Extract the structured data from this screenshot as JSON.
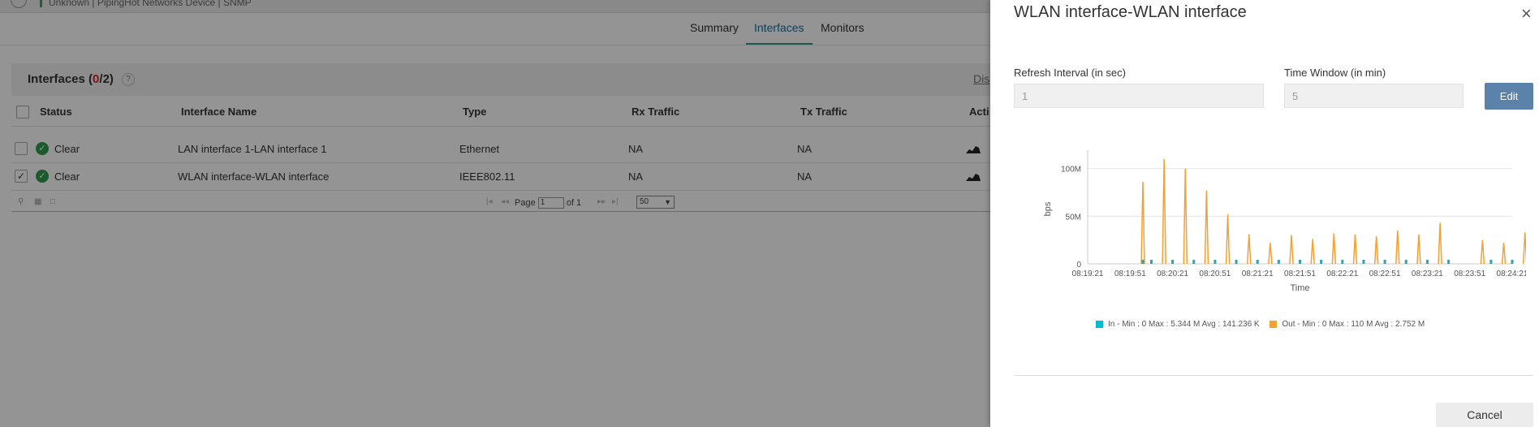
{
  "topbar": {
    "breadcrumb": "Unknown | PipingHot Networks Device  | SNMP"
  },
  "tabs": [
    {
      "label": "Summary",
      "active": false
    },
    {
      "label": "Interfaces",
      "active": true
    },
    {
      "label": "Monitors",
      "active": false
    }
  ],
  "interfaces": {
    "title": "Interfaces",
    "count_open": "(",
    "count_selected": "0",
    "count_sep": "/",
    "count_total": "2",
    "count_close": ")",
    "help": "?",
    "disable_link": "Dis",
    "columns": [
      "Status",
      "Interface Name",
      "Type",
      "Rx Traffic",
      "Tx Traffic",
      "Acti"
    ],
    "rows": [
      {
        "checked": false,
        "status": "Clear",
        "name": "LAN interface 1-LAN interface 1",
        "type": "Ethernet",
        "rx": "NA",
        "tx": "NA"
      },
      {
        "checked": true,
        "status": "Clear",
        "name": "WLAN interface-WLAN interface",
        "type": "IEEE802.11",
        "rx": "NA",
        "tx": "NA"
      }
    ],
    "pager": {
      "page_label": "Page",
      "page_value": "1",
      "of_label": "of 1",
      "page_size": "50"
    }
  },
  "drawer": {
    "title": "WLAN interface-WLAN interface",
    "close_icon": "×",
    "refresh_label": "Refresh Interval (in sec)",
    "refresh_value": "1",
    "window_label": "Time Window (in min)",
    "window_value": "5",
    "edit_label": "Edit",
    "cancel_label": "Cancel"
  },
  "chart_data": {
    "type": "line",
    "title": "",
    "xlabel": "Time",
    "ylabel": "bps",
    "yticks": [
      "0",
      "50M",
      "100M"
    ],
    "ylim": [
      0,
      115
    ],
    "y_unit": "M",
    "xticks": [
      "08:19:21",
      "08:19:51",
      "08:20:21",
      "08:20:51",
      "08:21:21",
      "08:21:51",
      "08:22:21",
      "08:22:51",
      "08:23:21",
      "08:23:51",
      "08:24:21"
    ],
    "x": [
      0,
      1,
      2,
      3,
      4,
      5,
      6,
      7,
      8,
      9,
      10
    ],
    "series": [
      {
        "name": "In - Min : 0 Max : 5.344 M Avg : 141.236 K",
        "color": "#00bcd4",
        "points": [
          [
            1.3,
            0
          ],
          [
            1.5,
            0
          ],
          [
            2.0,
            0
          ],
          [
            2.5,
            0
          ],
          [
            3.0,
            0
          ],
          [
            3.5,
            0
          ],
          [
            4.0,
            0
          ],
          [
            4.5,
            0
          ],
          [
            5.0,
            0
          ],
          [
            5.5,
            0
          ],
          [
            6.0,
            0
          ],
          [
            6.5,
            0
          ],
          [
            7.0,
            0
          ],
          [
            7.5,
            0
          ],
          [
            8.0,
            0
          ],
          [
            8.5,
            0
          ],
          [
            9.5,
            0
          ],
          [
            10.0,
            0
          ],
          [
            10.5,
            0
          ]
        ]
      },
      {
        "name": "Out - Min : 0 Max : 110 M Avg : 2.752 M",
        "color": "#f5a033",
        "spikes": [
          [
            1.3,
            86
          ],
          [
            1.8,
            110
          ],
          [
            2.3,
            100
          ],
          [
            2.8,
            77
          ],
          [
            3.3,
            52
          ],
          [
            3.8,
            31
          ],
          [
            4.3,
            22
          ],
          [
            4.8,
            30
          ],
          [
            5.3,
            26
          ],
          [
            5.8,
            32
          ],
          [
            6.3,
            31
          ],
          [
            6.8,
            29
          ],
          [
            7.3,
            35
          ],
          [
            7.8,
            31
          ],
          [
            8.3,
            43
          ],
          [
            9.3,
            25
          ],
          [
            9.8,
            22
          ],
          [
            10.3,
            33
          ]
        ]
      }
    ],
    "grid": true,
    "legend_position": "bottom"
  },
  "colors": {
    "accent": "#2b9e8f",
    "link": "#1c6b9c",
    "edit": "#5b82a8",
    "ok": "#2e9b4e",
    "error": "#e02424"
  }
}
